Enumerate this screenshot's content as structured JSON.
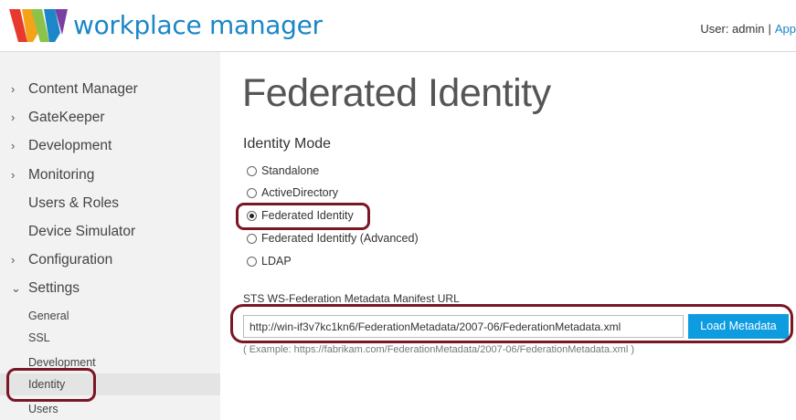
{
  "header": {
    "brand": "workplace manager",
    "user_text": "User: admin",
    "separator": "|",
    "app_link": "App"
  },
  "sidebar": {
    "items": [
      {
        "label": "Content Manager",
        "chevron": "›"
      },
      {
        "label": "GateKeeper",
        "chevron": "›"
      },
      {
        "label": "Development",
        "chevron": "›"
      },
      {
        "label": "Monitoring",
        "chevron": "›"
      },
      {
        "label": "Users & Roles",
        "chevron": ""
      },
      {
        "label": "Device Simulator",
        "chevron": ""
      },
      {
        "label": "Configuration",
        "chevron": "›"
      },
      {
        "label": "Settings",
        "chevron": "⌄"
      }
    ],
    "sub_items": [
      {
        "label": "General"
      },
      {
        "label": "SSL"
      },
      {
        "label": "Development"
      },
      {
        "label": "Identity"
      },
      {
        "label": "Users"
      }
    ]
  },
  "main": {
    "title": "Federated Identity",
    "mode_heading": "Identity Mode",
    "options": [
      {
        "label": "Standalone",
        "checked": false
      },
      {
        "label": "ActiveDirectory",
        "checked": false
      },
      {
        "label": "Federated Identity",
        "checked": true
      },
      {
        "label": "Federated Identitfy (Advanced)",
        "checked": false
      },
      {
        "label": "LDAP",
        "checked": false
      }
    ],
    "sts_label": "STS WS-Federation Metadata Manifest URL",
    "url_value": "http://win-if3v7kc1kn6/FederationMetadata/2007-06/FederationMetadata.xml",
    "load_button": "Load Metadata",
    "example": "( Example: https://fabrikam.com/FederationMetadata/2007-06/FederationMetadata.xml )"
  },
  "colors": {
    "brand": "#1b86c8",
    "button": "#0d9ce0",
    "highlight": "#7a1625"
  }
}
